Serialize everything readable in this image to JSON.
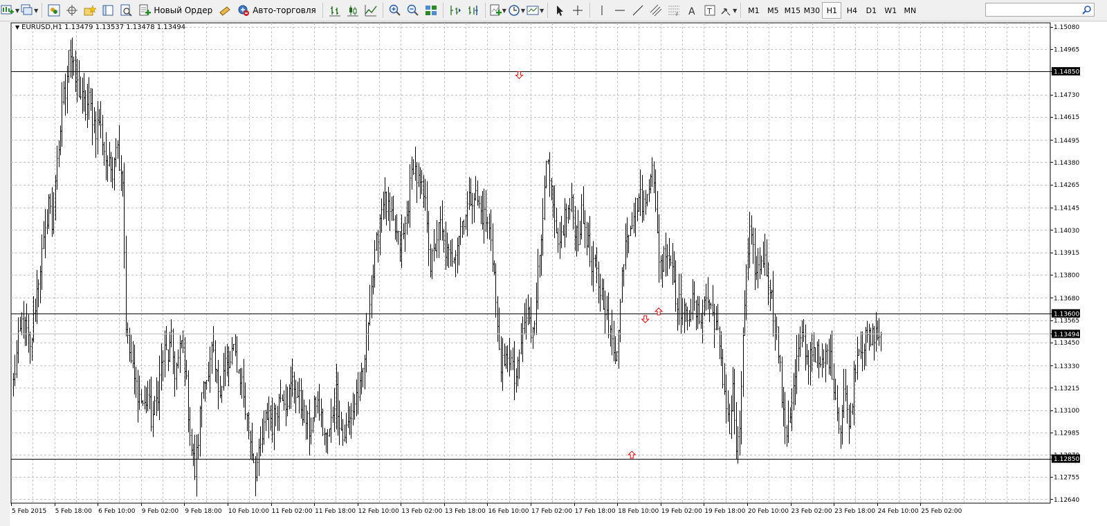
{
  "toolbar": {
    "new_order_label": "Новый Ордер",
    "auto_trading_label": "Авто-торговля",
    "timeframes": [
      "M1",
      "M5",
      "M15",
      "M30",
      "H1",
      "H4",
      "D1",
      "W1",
      "MN"
    ],
    "active_timeframe": "H1",
    "search_placeholder": ""
  },
  "chart_header": {
    "symbol": "EURUSD,H1",
    "ohlc": "1.13479 1.13537 1.13478 1.13494"
  },
  "colors": {
    "bar": "#000000",
    "grid": "#c0c0c0",
    "arrow": "#ff0000",
    "hline": "#000000",
    "bid_line": "#c0c0c0"
  },
  "chart_data": {
    "type": "ohlc",
    "symbol": "EURUSD",
    "timeframe": "H1",
    "price_labels": [
      "1.15080",
      "1.14965",
      "1.14850",
      "1.14730",
      "1.14615",
      "1.14495",
      "1.14380",
      "1.14265",
      "1.14145",
      "1.14030",
      "1.13915",
      "1.13800",
      "1.13680",
      "1.13600",
      "1.13565",
      "1.13494",
      "1.13450",
      "1.13330",
      "1.13215",
      "1.13100",
      "1.12985",
      "1.12870",
      "1.12850",
      "1.12755",
      "1.12640"
    ],
    "grid_prices": [
      1.1508,
      1.14965,
      1.1473,
      1.14615,
      1.14495,
      1.1438,
      1.14265,
      1.14145,
      1.1403,
      1.13915,
      1.138,
      1.1368,
      1.13565,
      1.1345,
      1.1333,
      1.13215,
      1.131,
      1.12985,
      1.1287,
      1.12755,
      1.1264
    ],
    "time_labels": [
      "5 Feb 2015",
      "5 Feb 18:00",
      "6 Feb 10:00",
      "9 Feb 02:00",
      "9 Feb 18:00",
      "10 Feb 10:00",
      "11 Feb 02:00",
      "11 Feb 18:00",
      "12 Feb 10:00",
      "13 Feb 02:00",
      "13 Feb 18:00",
      "16 Feb 10:00",
      "17 Feb 02:00",
      "17 Feb 18:00",
      "18 Feb 10:00",
      "19 Feb 02:00",
      "19 Feb 18:00",
      "20 Feb 10:00",
      "23 Feb 02:00",
      "23 Feb 18:00",
      "24 Feb 10:00",
      "25 Feb 02:00"
    ],
    "ylim": [
      1.1262,
      1.151
    ],
    "horizontal_lines": [
      {
        "price": 1.1485,
        "label": "1.14850"
      },
      {
        "price": 1.136,
        "label": "1.13600"
      },
      {
        "price": 1.1285,
        "label": "1.12850"
      }
    ],
    "bid_line": {
      "price": 1.13494,
      "label": "1.13494"
    },
    "arrows": [
      {
        "direction": "down",
        "bar": 301,
        "price": 1.1483
      },
      {
        "direction": "down",
        "bar": 376,
        "price": 1.1357
      },
      {
        "direction": "up",
        "bar": 384,
        "price": 1.1361
      },
      {
        "direction": "up",
        "bar": 368,
        "price": 1.1287
      }
    ],
    "anchors": [
      [
        0,
        1.1324
      ],
      [
        3,
        1.1345
      ],
      [
        5,
        1.1355
      ],
      [
        8,
        1.135
      ],
      [
        10,
        1.134
      ],
      [
        13,
        1.1365
      ],
      [
        16,
        1.1385
      ],
      [
        19,
        1.14
      ],
      [
        21,
        1.142
      ],
      [
        23,
        1.1405
      ],
      [
        25,
        1.143
      ],
      [
        27,
        1.144
      ],
      [
        29,
        1.147
      ],
      [
        31,
        1.1475
      ],
      [
        33,
        1.1498
      ],
      [
        35,
        1.149
      ],
      [
        37,
        1.148
      ],
      [
        39,
        1.1475
      ],
      [
        41,
        1.147
      ],
      [
        43,
        1.1465
      ],
      [
        45,
        1.147
      ],
      [
        47,
        1.1462
      ],
      [
        49,
        1.1455
      ],
      [
        51,
        1.146
      ],
      [
        53,
        1.145
      ],
      [
        55,
        1.144
      ],
      [
        57,
        1.1435
      ],
      [
        59,
        1.1435
      ],
      [
        61,
        1.145
      ],
      [
        63,
        1.144
      ],
      [
        65,
        1.143
      ],
      [
        67,
        1.1355
      ],
      [
        68,
        1.1345
      ],
      [
        70,
        1.1335
      ],
      [
        72,
        1.1325
      ],
      [
        74,
        1.132
      ],
      [
        76,
        1.1315
      ],
      [
        78,
        1.1312
      ],
      [
        80,
        1.1318
      ],
      [
        82,
        1.1305
      ],
      [
        84,
        1.131
      ],
      [
        86,
        1.132
      ],
      [
        88,
        1.1333
      ],
      [
        90,
        1.134
      ],
      [
        92,
        1.1338
      ],
      [
        94,
        1.1345
      ],
      [
        96,
        1.133
      ],
      [
        98,
        1.1335
      ],
      [
        100,
        1.1345
      ],
      [
        102,
        1.1335
      ],
      [
        104,
        1.131
      ],
      [
        106,
        1.129
      ],
      [
        108,
        1.1278
      ],
      [
        110,
        1.1295
      ],
      [
        112,
        1.132
      ],
      [
        114,
        1.133
      ],
      [
        116,
        1.1325
      ],
      [
        118,
        1.134
      ],
      [
        120,
        1.133
      ],
      [
        122,
        1.1322
      ],
      [
        124,
        1.1325
      ],
      [
        126,
        1.1335
      ],
      [
        128,
        1.133
      ],
      [
        130,
        1.134
      ],
      [
        132,
        1.1338
      ],
      [
        134,
        1.133
      ],
      [
        136,
        1.1325
      ],
      [
        138,
        1.131
      ],
      [
        140,
        1.13
      ],
      [
        142,
        1.129
      ],
      [
        144,
        1.128
      ],
      [
        146,
        1.1285
      ],
      [
        148,
        1.1295
      ],
      [
        150,
        1.1305
      ],
      [
        152,
        1.131
      ],
      [
        154,
        1.1302
      ],
      [
        156,
        1.131
      ],
      [
        158,
        1.1315
      ],
      [
        160,
        1.132
      ],
      [
        162,
        1.1315
      ],
      [
        164,
        1.1318
      ],
      [
        166,
        1.1325
      ],
      [
        168,
        1.132
      ],
      [
        170,
        1.1315
      ],
      [
        172,
        1.131
      ],
      [
        174,
        1.1305
      ],
      [
        176,
        1.13
      ],
      [
        178,
        1.1305
      ],
      [
        180,
        1.1315
      ],
      [
        182,
        1.131
      ],
      [
        184,
        1.13
      ],
      [
        186,
        1.1295
      ],
      [
        188,
        1.1298
      ],
      [
        190,
        1.131
      ],
      [
        192,
        1.132
      ],
      [
        194,
        1.1305
      ],
      [
        196,
        1.1295
      ],
      [
        198,
        1.13
      ],
      [
        200,
        1.1305
      ],
      [
        202,
        1.131
      ],
      [
        204,
        1.1318
      ],
      [
        206,
        1.132
      ],
      [
        208,
        1.133
      ],
      [
        210,
        1.1345
      ],
      [
        212,
        1.137
      ],
      [
        214,
        1.138
      ],
      [
        216,
        1.1395
      ],
      [
        218,
        1.141
      ],
      [
        220,
        1.142
      ],
      [
        222,
        1.1415
      ],
      [
        224,
        1.141
      ],
      [
        226,
        1.1405
      ],
      [
        228,
        1.14
      ],
      [
        230,
        1.1395
      ],
      [
        232,
        1.14
      ],
      [
        234,
        1.141
      ],
      [
        236,
        1.1425
      ],
      [
        238,
        1.1438
      ],
      [
        240,
        1.143
      ],
      [
        242,
        1.1425
      ],
      [
        244,
        1.142
      ],
      [
        246,
        1.141
      ],
      [
        248,
        1.1385
      ],
      [
        250,
        1.139
      ],
      [
        252,
        1.14
      ],
      [
        254,
        1.1405
      ],
      [
        256,
        1.1395
      ],
      [
        258,
        1.139
      ],
      [
        260,
        1.1388
      ],
      [
        262,
        1.1392
      ],
      [
        264,
        1.1398
      ],
      [
        266,
        1.1405
      ],
      [
        268,
        1.141
      ],
      [
        270,
        1.1415
      ],
      [
        272,
        1.142
      ],
      [
        274,
        1.1422
      ],
      [
        276,
        1.1418
      ],
      [
        278,
        1.1412
      ],
      [
        280,
        1.141
      ],
      [
        282,
        1.1405
      ],
      [
        284,
        1.14
      ],
      [
        286,
        1.138
      ],
      [
        288,
        1.135
      ],
      [
        290,
        1.1335
      ],
      [
        292,
        1.133
      ],
      [
        294,
        1.134
      ],
      [
        296,
        1.1335
      ],
      [
        298,
        1.1325
      ],
      [
        300,
        1.133
      ],
      [
        302,
        1.1345
      ],
      [
        304,
        1.1355
      ],
      [
        306,
        1.136
      ],
      [
        308,
        1.135
      ],
      [
        310,
        1.136
      ],
      [
        312,
        1.138
      ],
      [
        314,
        1.14
      ],
      [
        316,
        1.143
      ],
      [
        318,
        1.1435
      ],
      [
        320,
        1.142
      ],
      [
        322,
        1.1405
      ],
      [
        324,
        1.139
      ],
      [
        326,
        1.14
      ],
      [
        328,
        1.141
      ],
      [
        330,
        1.1412
      ],
      [
        332,
        1.1415
      ],
      [
        334,
        1.1405
      ],
      [
        336,
        1.14
      ],
      [
        338,
        1.141
      ],
      [
        340,
        1.1405
      ],
      [
        342,
        1.1395
      ],
      [
        344,
        1.138
      ],
      [
        346,
        1.1385
      ],
      [
        348,
        1.1375
      ],
      [
        350,
        1.137
      ],
      [
        352,
        1.1365
      ],
      [
        354,
        1.135
      ],
      [
        356,
        1.1345
      ],
      [
        358,
        1.134
      ],
      [
        360,
        1.135
      ],
      [
        362,
        1.138
      ],
      [
        364,
        1.14
      ],
      [
        366,
        1.1405
      ],
      [
        368,
        1.141
      ],
      [
        370,
        1.1415
      ],
      [
        372,
        1.142
      ],
      [
        374,
        1.1418
      ],
      [
        376,
        1.1415
      ],
      [
        378,
        1.143
      ],
      [
        380,
        1.144
      ],
      [
        382,
        1.141
      ],
      [
        384,
        1.139
      ],
      [
        386,
        1.1385
      ],
      [
        388,
        1.1395
      ],
      [
        390,
        1.139
      ],
      [
        392,
        1.1385
      ],
      [
        394,
        1.137
      ],
      [
        396,
        1.1365
      ],
      [
        398,
        1.136
      ],
      [
        400,
        1.1358
      ],
      [
        402,
        1.1362
      ],
      [
        404,
        1.1365
      ],
      [
        406,
        1.136
      ],
      [
        408,
        1.1358
      ],
      [
        410,
        1.1362
      ],
      [
        412,
        1.1368
      ],
      [
        414,
        1.1365
      ],
      [
        416,
        1.136
      ],
      [
        418,
        1.1355
      ],
      [
        420,
        1.134
      ],
      [
        422,
        1.1325
      ],
      [
        424,
        1.1315
      ],
      [
        426,
        1.13
      ],
      [
        428,
        1.132
      ],
      [
        430,
        1.129
      ],
      [
        432,
        1.1295
      ],
      [
        434,
        1.135
      ],
      [
        436,
        1.138
      ],
      [
        438,
        1.14
      ],
      [
        440,
        1.139
      ],
      [
        442,
        1.138
      ],
      [
        444,
        1.1385
      ],
      [
        446,
        1.139
      ],
      [
        448,
        1.1382
      ],
      [
        450,
        1.1375
      ],
      [
        452,
        1.136
      ],
      [
        454,
        1.135
      ],
      [
        456,
        1.133
      ],
      [
        458,
        1.1305
      ],
      [
        460,
        1.13
      ],
      [
        462,
        1.131
      ],
      [
        464,
        1.132
      ],
      [
        466,
        1.1335
      ],
      [
        468,
        1.1345
      ],
      [
        470,
        1.1345
      ],
      [
        472,
        1.1335
      ],
      [
        474,
        1.134
      ],
      [
        476,
        1.1343
      ],
      [
        478,
        1.1338
      ],
      [
        480,
        1.133
      ],
      [
        482,
        1.1335
      ],
      [
        484,
        1.134
      ],
      [
        486,
        1.1335
      ],
      [
        488,
        1.1325
      ],
      [
        490,
        1.131
      ],
      [
        492,
        1.13
      ],
      [
        494,
        1.132
      ],
      [
        496,
        1.131
      ],
      [
        498,
        1.1305
      ],
      [
        500,
        1.133
      ],
      [
        502,
        1.134
      ],
      [
        504,
        1.1345
      ],
      [
        506,
        1.1343
      ],
      [
        508,
        1.1348
      ],
      [
        510,
        1.1345
      ],
      [
        512,
        1.135
      ],
      [
        514,
        1.1348
      ],
      [
        516,
        1.1349
      ]
    ]
  }
}
